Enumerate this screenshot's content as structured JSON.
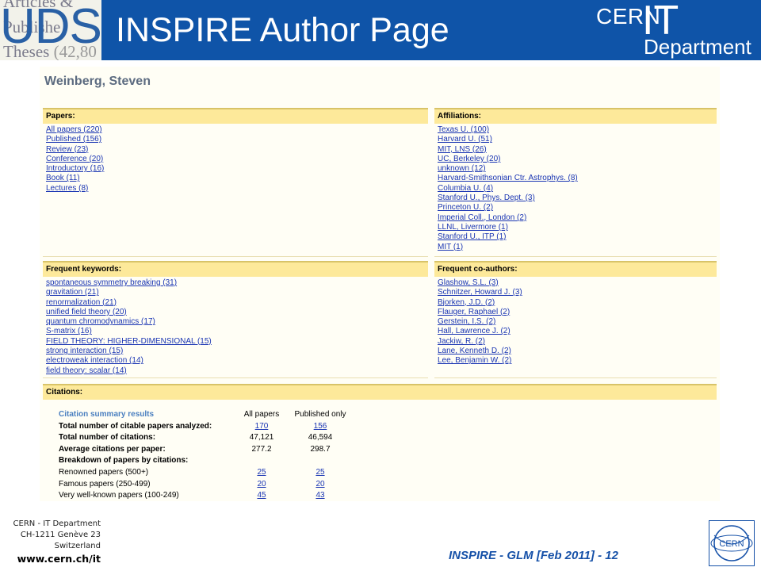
{
  "header": {
    "title": "INSPIRE Author Page",
    "uds_logo": {
      "text": "UDS",
      "background_lines": [
        "Articles &",
        "Publishe",
        "Theses"
      ],
      "background_number": "(42,80"
    },
    "cern_logo": {
      "cern": "CERN",
      "it": "IT",
      "department": "Department"
    }
  },
  "author": {
    "name": "Weinberg, Steven"
  },
  "papers": {
    "heading": "Papers:",
    "items": [
      "All papers (220)",
      "Published (156)",
      "Review (23)",
      "Conference (20)",
      "Introductory (16)",
      "Book (11)",
      "Lectures (8)"
    ]
  },
  "affiliations": {
    "heading": "Affiliations:",
    "items": [
      "Texas U. (100)",
      "Harvard U. (51)",
      "MIT, LNS (26)",
      "UC, Berkeley (20)",
      "unknown (12)",
      "Harvard-Smithsonian Ctr. Astrophys. (8)",
      "Columbia U. (4)",
      "Stanford U., Phys. Dept. (3)",
      "Princeton U. (2)",
      "Imperial Coll., London (2)",
      "LLNL, Livermore (1)",
      "Stanford U., ITP (1)",
      "MIT (1)"
    ]
  },
  "keywords": {
    "heading": "Frequent keywords:",
    "items": [
      "spontaneous symmetry breaking (31)",
      "gravitation (21)",
      "renormalization (21)",
      "unified field theory (20)",
      "quantum chromodynamics (17)",
      "S-matrix (16)",
      "FIELD THEORY: HIGHER-DIMENSIONAL (15)",
      "strong interaction (15)",
      "electroweak interaction (14)",
      "field theory: scalar (14)"
    ]
  },
  "coauthors": {
    "heading": "Frequent co-authors:",
    "items": [
      "Glashow, S.L. (3)",
      "Schnitzer, Howard J. (3)",
      "Bjorken, J.D. (2)",
      "Flauger, Raphael (2)",
      "Gerstein, I.S. (2)",
      "Hall, Lawrence J. (2)",
      "Jackiw, R. (2)",
      "Lane, Kenneth D. (2)",
      "Lee, Benjamin W. (2)"
    ]
  },
  "citations": {
    "heading": "Citations:",
    "summary_title": "Citation summary results",
    "col_all": "All papers",
    "col_published": "Published only",
    "rows": {
      "citable": {
        "label": "Total number of citable papers analyzed:",
        "all": "170",
        "published": "156"
      },
      "total": {
        "label": "Total number of citations:",
        "all": "47,121",
        "published": "46,594"
      },
      "average": {
        "label": "Average citations per paper:",
        "all": "277.2",
        "published": "298.7"
      },
      "breakdown": {
        "label": "Breakdown of papers by citations:"
      },
      "renowned": {
        "label": "Renowned papers (500+)",
        "all": "25",
        "published": "25"
      },
      "famous": {
        "label": "Famous papers (250-499)",
        "all": "20",
        "published": "20"
      },
      "wellknown": {
        "label": "Very well-known papers (100-249)",
        "all": "45",
        "published": "43"
      }
    }
  },
  "footer": {
    "address_lines": [
      "CERN - IT Department",
      "CH-1211 Genève 23",
      "Switzerland"
    ],
    "url": "www.cern.ch/it",
    "slide_label": "INSPIRE - GLM [Feb 2011] - 12",
    "badge_text": "CERN"
  },
  "colors": {
    "header_blue": "#0f54a8",
    "panel_head": "#fde99a",
    "link": "#1a35b3",
    "page_bg": "#fffef5"
  }
}
